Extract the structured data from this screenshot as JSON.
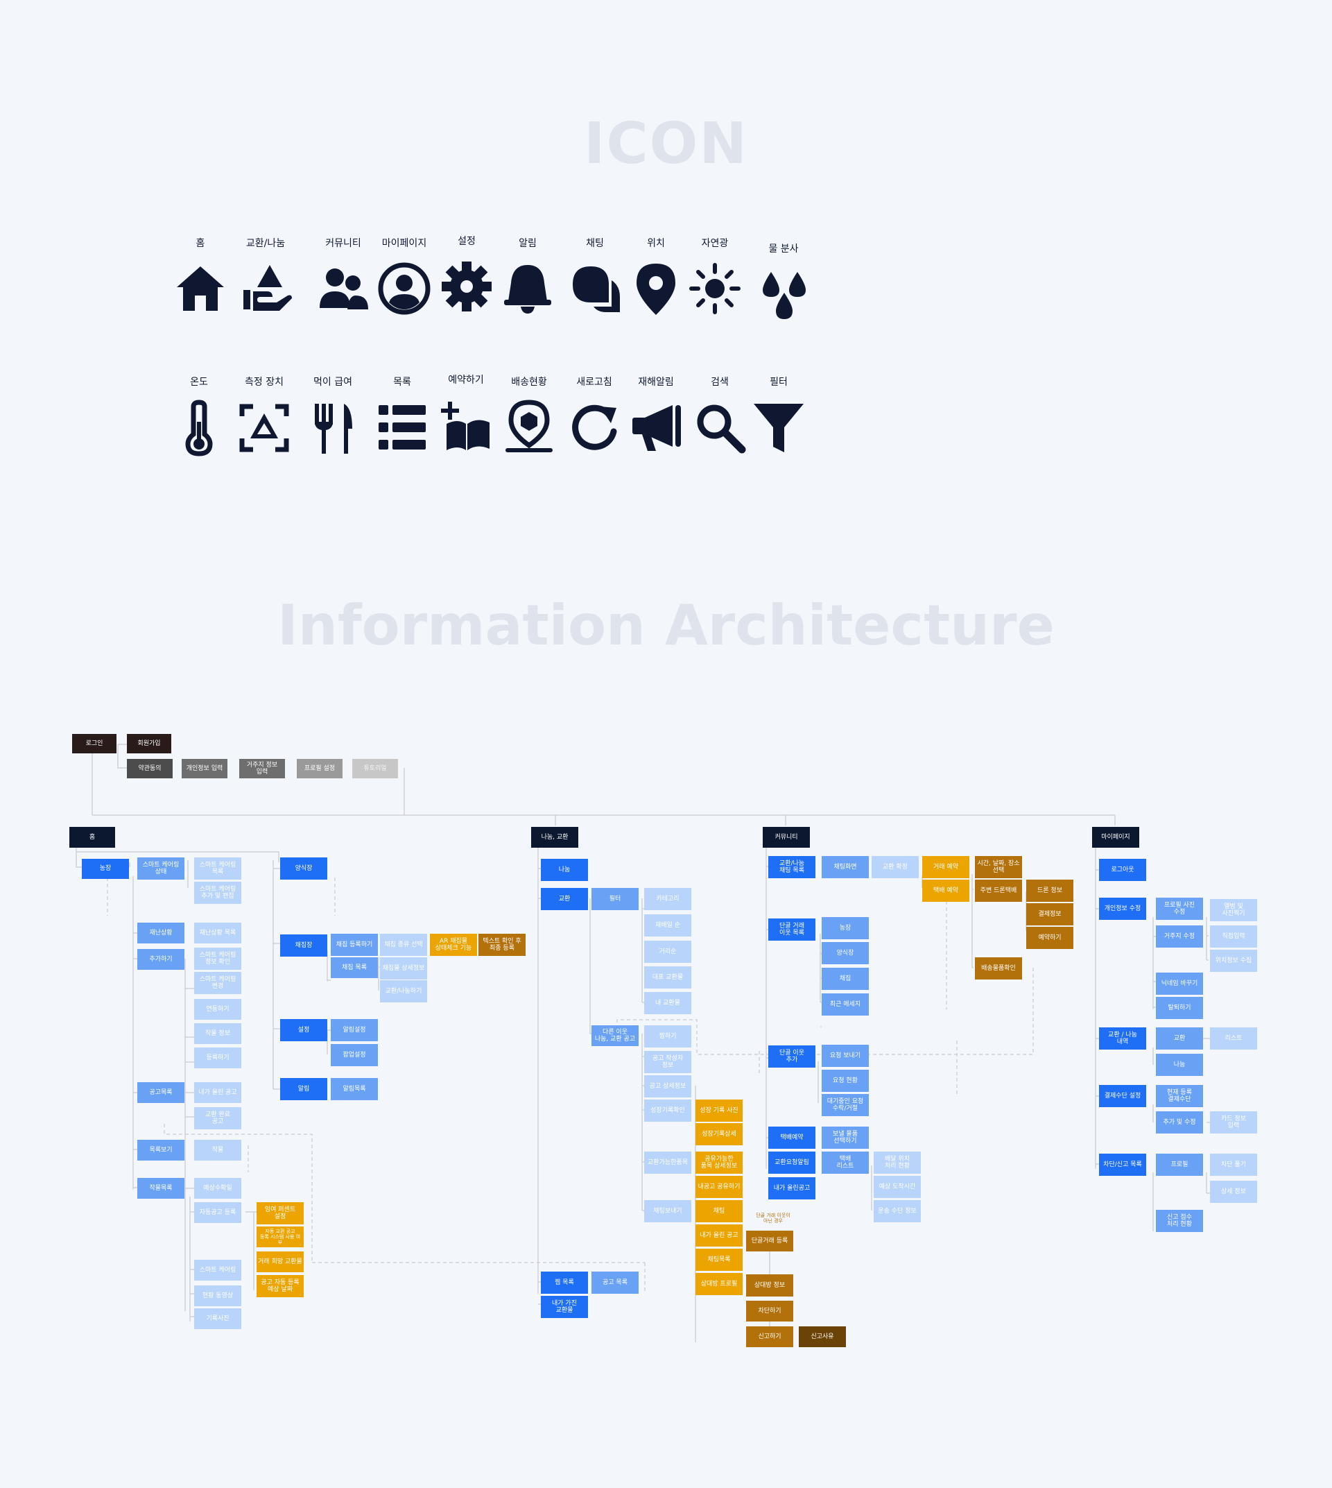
{
  "titles": {
    "icon_section": "ICON",
    "ia_section": "Information Architecture"
  },
  "colors": {
    "icon": "#0f1731",
    "title": "#dfe3ec",
    "dark": "#2a1b1b",
    "navy": "#0c1730",
    "blue_primary": "#1e6ff5",
    "blue_secondary": "#69a2f5",
    "blue_tertiary": "#b8d4fb",
    "orange": "#eca400",
    "brown": "#b2710b",
    "dark_brown": "#6b4306"
  },
  "icons": [
    {
      "label": "홈",
      "icon": "home-icon"
    },
    {
      "label": "교환/나눔",
      "icon": "share-hand-icon"
    },
    {
      "label": "커뮤니티",
      "icon": "users-icon"
    },
    {
      "label": "마이페이지",
      "icon": "user-circle-icon"
    },
    {
      "label": "설정",
      "icon": "gear-icon"
    },
    {
      "label": "알림",
      "icon": "bell-icon"
    },
    {
      "label": "채팅",
      "icon": "chat-icon"
    },
    {
      "label": "위치",
      "icon": "location-pin-icon"
    },
    {
      "label": "자연광",
      "icon": "sun-icon"
    },
    {
      "label": "물 분사",
      "icon": "water-drops-icon"
    },
    {
      "label": "온도",
      "icon": "thermometer-icon"
    },
    {
      "label": "측정 장치",
      "icon": "scan-device-icon"
    },
    {
      "label": "먹이 급여",
      "icon": "fork-knife-icon"
    },
    {
      "label": "목록",
      "icon": "list-icon"
    },
    {
      "label": "예약하기",
      "icon": "book-plus-icon"
    },
    {
      "label": "배송현황",
      "icon": "delivery-pin-icon"
    },
    {
      "label": "새로고침",
      "icon": "refresh-icon"
    },
    {
      "label": "재해알림",
      "icon": "megaphone-icon"
    },
    {
      "label": "검색",
      "icon": "search-icon"
    },
    {
      "label": "필터",
      "icon": "filter-icon"
    }
  ],
  "ia_nodes": [
    {
      "text": "로그인",
      "c": "dark"
    },
    {
      "text": "회원가입",
      "c": "dark"
    },
    {
      "text": "약관동의",
      "c": "gray1"
    },
    {
      "text": "개인정보 입력",
      "c": "gray2"
    },
    {
      "text": "거주지 정보\n입력",
      "c": "gray2"
    },
    {
      "text": "프로필 설정",
      "c": "gray3"
    },
    {
      "text": "튜토리얼",
      "c": "gray4"
    },
    {
      "text": "홈",
      "c": "navy"
    },
    {
      "text": "농장",
      "c": "blue1"
    },
    {
      "text": "스마트 케어링\n상태",
      "c": "blue2"
    },
    {
      "text": "스마트 케어링\n목록",
      "c": "blue3"
    },
    {
      "text": "스마트 케어링\n추가 및 편집",
      "c": "blue3"
    },
    {
      "text": "재난상황",
      "c": "blue2"
    },
    {
      "text": "재난상황 목록",
      "c": "blue3"
    },
    {
      "text": "추가하기",
      "c": "blue2"
    },
    {
      "text": "스마트 케어링\n정보 확인",
      "c": "blue3"
    },
    {
      "text": "스마트 케어링\n변경",
      "c": "blue3"
    },
    {
      "text": "연동하기",
      "c": "blue3"
    },
    {
      "text": "작물 정보",
      "c": "blue3"
    },
    {
      "text": "등록하기",
      "c": "blue3"
    },
    {
      "text": "공고목록",
      "c": "blue2"
    },
    {
      "text": "내가 올린 공고",
      "c": "blue3"
    },
    {
      "text": "교환 완료\n공고",
      "c": "blue3"
    },
    {
      "text": "목록보기",
      "c": "blue2"
    },
    {
      "text": "작물",
      "c": "blue3"
    },
    {
      "text": "작물목록",
      "c": "blue2"
    },
    {
      "text": "예상수확일",
      "c": "blue3"
    },
    {
      "text": "자동공고 등록",
      "c": "blue3"
    },
    {
      "text": "잉여 퍼센트\n설정",
      "c": "orange"
    },
    {
      "text": "자동 교환 공고\n등록 시스템 사용 여부",
      "c": "orange"
    },
    {
      "text": "거래 희망 교환물",
      "c": "orange"
    },
    {
      "text": "공고 자동 등록\n예상 날짜",
      "c": "orange"
    },
    {
      "text": "스마트 케어링",
      "c": "blue3"
    },
    {
      "text": "현황 동영상",
      "c": "blue3"
    },
    {
      "text": "기록사진",
      "c": "blue3"
    },
    {
      "text": "양식장",
      "c": "blue1"
    },
    {
      "text": "채집장",
      "c": "blue1"
    },
    {
      "text": "채집 등록하기",
      "c": "blue2"
    },
    {
      "text": "채집 종류 선택",
      "c": "blue3"
    },
    {
      "text": "AR 채집물\n상태체크 기능",
      "c": "orange"
    },
    {
      "text": "텍스트 확인 후\n최종 등록",
      "c": "brown"
    },
    {
      "text": "채집 목록",
      "c": "blue2"
    },
    {
      "text": "채집물 상세정보",
      "c": "blue3"
    },
    {
      "text": "교환/나눔하기",
      "c": "blue3"
    },
    {
      "text": "설정",
      "c": "blue1"
    },
    {
      "text": "알림설정",
      "c": "blue2"
    },
    {
      "text": "팝업설정",
      "c": "blue2"
    },
    {
      "text": "알림",
      "c": "blue1"
    },
    {
      "text": "알림목록",
      "c": "blue2"
    },
    {
      "text": "나눔, 교환",
      "c": "navy"
    },
    {
      "text": "나눔",
      "c": "blue1"
    },
    {
      "text": "교환",
      "c": "blue1"
    },
    {
      "text": "필터",
      "c": "blue2"
    },
    {
      "text": "카테고리",
      "c": "blue3"
    },
    {
      "text": "재배일 순",
      "c": "blue3"
    },
    {
      "text": "거리순",
      "c": "blue3"
    },
    {
      "text": "대표 교환물",
      "c": "blue3"
    },
    {
      "text": "내 교환물",
      "c": "blue3"
    },
    {
      "text": "다른 이웃\n나눔, 교환 공고",
      "c": "blue2"
    },
    {
      "text": "찜하기",
      "c": "blue3"
    },
    {
      "text": "공고 작성자\n정보",
      "c": "blue3"
    },
    {
      "text": "공고 상세정보",
      "c": "blue3"
    },
    {
      "text": "성장기록확인",
      "c": "blue3"
    },
    {
      "text": "성장 기록 사진",
      "c": "orange"
    },
    {
      "text": "성장기록상세",
      "c": "orange"
    },
    {
      "text": "교환가능한품목",
      "c": "blue3"
    },
    {
      "text": "공유가능한\n품목 상세정보",
      "c": "orange"
    },
    {
      "text": "내공고 공유하기",
      "c": "orange"
    },
    {
      "text": "채팅보내기",
      "c": "blue3"
    },
    {
      "text": "채팅",
      "c": "orange"
    },
    {
      "text": "내가 올린 공고",
      "c": "orange"
    },
    {
      "text": "채팅목록",
      "c": "orange"
    },
    {
      "text": "상대방 프로필",
      "c": "orange"
    },
    {
      "text": "단골거래 등록",
      "c": "brown"
    },
    {
      "text": "상대방 정보",
      "c": "brown"
    },
    {
      "text": "차단하기",
      "c": "brown"
    },
    {
      "text": "신고하기",
      "c": "brown"
    },
    {
      "text": "신고사유",
      "c": "dbrown"
    },
    {
      "text": "찜 목록",
      "c": "blue1"
    },
    {
      "text": "공고 목록",
      "c": "blue2"
    },
    {
      "text": "내가 가진\n교환물",
      "c": "blue1"
    },
    {
      "text": "커뮤니티",
      "c": "navy"
    },
    {
      "text": "교환/나눔\n채팅 목록",
      "c": "blue1"
    },
    {
      "text": "채팅화면",
      "c": "blue2"
    },
    {
      "text": "교환 확정",
      "c": "blue3"
    },
    {
      "text": "거래 예약",
      "c": "orange"
    },
    {
      "text": "시간, 날짜, 장소\n선택",
      "c": "brown"
    },
    {
      "text": "택배 예약",
      "c": "orange"
    },
    {
      "text": "주변 드론택배",
      "c": "brown"
    },
    {
      "text": "드론 정보",
      "c": "brown"
    },
    {
      "text": "결제정보",
      "c": "brown"
    },
    {
      "text": "예약하기",
      "c": "brown"
    },
    {
      "text": "배송물품확인",
      "c": "brown"
    },
    {
      "text": "단골 거래\n이웃 목록",
      "c": "blue1"
    },
    {
      "text": "농장",
      "c": "blue2"
    },
    {
      "text": "양식장",
      "c": "blue2"
    },
    {
      "text": "채집",
      "c": "blue2"
    },
    {
      "text": "최근 메세지",
      "c": "blue2"
    },
    {
      "text": "단골 이웃\n추가",
      "c": "blue1"
    },
    {
      "text": "요청 보내기",
      "c": "blue2"
    },
    {
      "text": "요청 현황",
      "c": "blue2"
    },
    {
      "text": "대기중인 요청\n수락/거절",
      "c": "blue2"
    },
    {
      "text": "택배예약",
      "c": "blue1"
    },
    {
      "text": "보낼 물품\n선택하기",
      "c": "blue2"
    },
    {
      "text": "교환요청알림",
      "c": "blue1"
    },
    {
      "text": "택배\n리스트",
      "c": "blue2"
    },
    {
      "text": "배달 위치\n처리 현황",
      "c": "blue3"
    },
    {
      "text": "예상 도착시간",
      "c": "blue3"
    },
    {
      "text": "운송 수단 정보",
      "c": "blue3"
    },
    {
      "text": "내가 올린공고",
      "c": "blue1"
    },
    {
      "text": "마이페이지",
      "c": "navy"
    },
    {
      "text": "로그아웃",
      "c": "blue1"
    },
    {
      "text": "개인정보 수정",
      "c": "blue1"
    },
    {
      "text": "프로필 사진\n수정",
      "c": "blue2"
    },
    {
      "text": "앨범 및\n사진찍기",
      "c": "blue3"
    },
    {
      "text": "거주지 수정",
      "c": "blue2"
    },
    {
      "text": "직접입력",
      "c": "blue3"
    },
    {
      "text": "위치정보 수집",
      "c": "blue3"
    },
    {
      "text": "닉네임 바꾸기",
      "c": "blue2"
    },
    {
      "text": "탈퇴하기",
      "c": "blue2"
    },
    {
      "text": "교환 / 나눔\n내역",
      "c": "blue1"
    },
    {
      "text": "교환",
      "c": "blue2"
    },
    {
      "text": "리스트",
      "c": "blue3"
    },
    {
      "text": "나눔",
      "c": "blue2"
    },
    {
      "text": "결제수단 설정",
      "c": "blue1"
    },
    {
      "text": "현재 등록\n결제수단",
      "c": "blue2"
    },
    {
      "text": "추가 및 수정",
      "c": "blue2"
    },
    {
      "text": "카드 정보\n입력",
      "c": "blue3"
    },
    {
      "text": "차단/신고 목록",
      "c": "blue1"
    },
    {
      "text": "프로필",
      "c": "blue2"
    },
    {
      "text": "차단 풀기",
      "c": "blue3"
    },
    {
      "text": "상세 정보",
      "c": "blue3"
    },
    {
      "text": "신고 접수\n처리 현황",
      "c": "blue2"
    }
  ],
  "ia_notes": [
    {
      "text": "단골 거래 이웃이\n아닌 경우"
    }
  ]
}
